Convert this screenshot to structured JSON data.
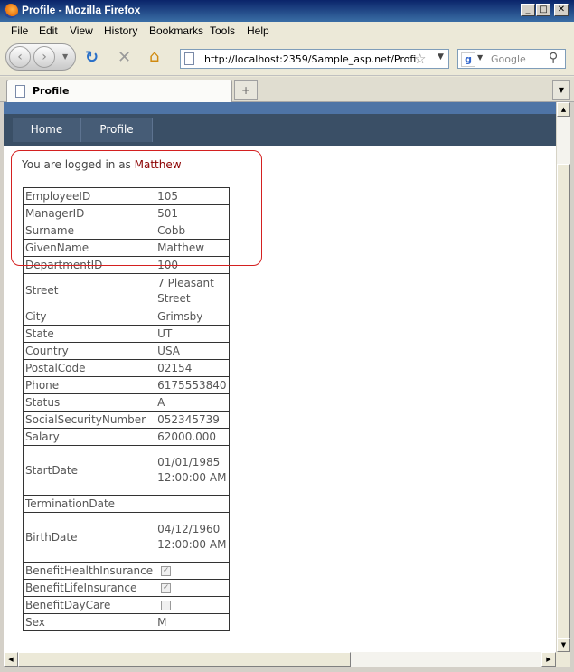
{
  "window": {
    "title": "Profile - Mozilla Firefox",
    "minimize_label": "_",
    "maximize_label": "□",
    "close_label": "✕"
  },
  "menu": [
    {
      "label": "File"
    },
    {
      "label": "Edit"
    },
    {
      "label": "View"
    },
    {
      "label": "History"
    },
    {
      "label": "Bookmarks"
    },
    {
      "label": "Tools"
    },
    {
      "label": "Help"
    }
  ],
  "toolbar": {
    "url": "http://localhost:2359/Sample_asp.net/Profile.a",
    "search_placeholder": "Google",
    "search_engine_letter": "g"
  },
  "tabs": {
    "active_title": "Profile",
    "new_tab_label": "+"
  },
  "site_nav": {
    "items": [
      {
        "label": "Home"
      },
      {
        "label": "Profile"
      }
    ]
  },
  "login": {
    "prefix": "You are logged in as",
    "user": "Matthew"
  },
  "profile": {
    "rows": [
      {
        "key": "EmployeeID",
        "value": "105"
      },
      {
        "key": "ManagerID",
        "value": "501"
      },
      {
        "key": "Surname",
        "value": "Cobb"
      },
      {
        "key": "GivenName",
        "value": "Matthew"
      },
      {
        "key": "DepartmentID",
        "value": "100"
      },
      {
        "key": "Street",
        "value": "7 Pleasant Street"
      },
      {
        "key": "City",
        "value": "Grimsby"
      },
      {
        "key": "State",
        "value": "UT"
      },
      {
        "key": "Country",
        "value": "USA"
      },
      {
        "key": "PostalCode",
        "value": "02154"
      },
      {
        "key": "Phone",
        "value": "6175553840"
      },
      {
        "key": "Status",
        "value": "A"
      },
      {
        "key": "SocialSecurityNumber",
        "value": "052345739"
      },
      {
        "key": "Salary",
        "value": "62000.000"
      },
      {
        "key": "StartDate",
        "value": "01/01/1985 12:00:00 AM"
      },
      {
        "key": "TerminationDate",
        "value": ""
      },
      {
        "key": "BirthDate",
        "value": "04/12/1960 12:00:00 AM"
      }
    ],
    "checkbox_rows": [
      {
        "key": "BenefitHealthInsurance",
        "checked": true
      },
      {
        "key": "BenefitLifeInsurance",
        "checked": true
      },
      {
        "key": "BenefitDayCare",
        "checked": false
      }
    ],
    "last_rows": [
      {
        "key": "Sex",
        "value": "M"
      }
    ]
  },
  "colors": {
    "nav_bar": "#3a4f66",
    "top_stripe": "#4e74a6",
    "highlight_box": "#d42020",
    "username": "#8b0000"
  }
}
